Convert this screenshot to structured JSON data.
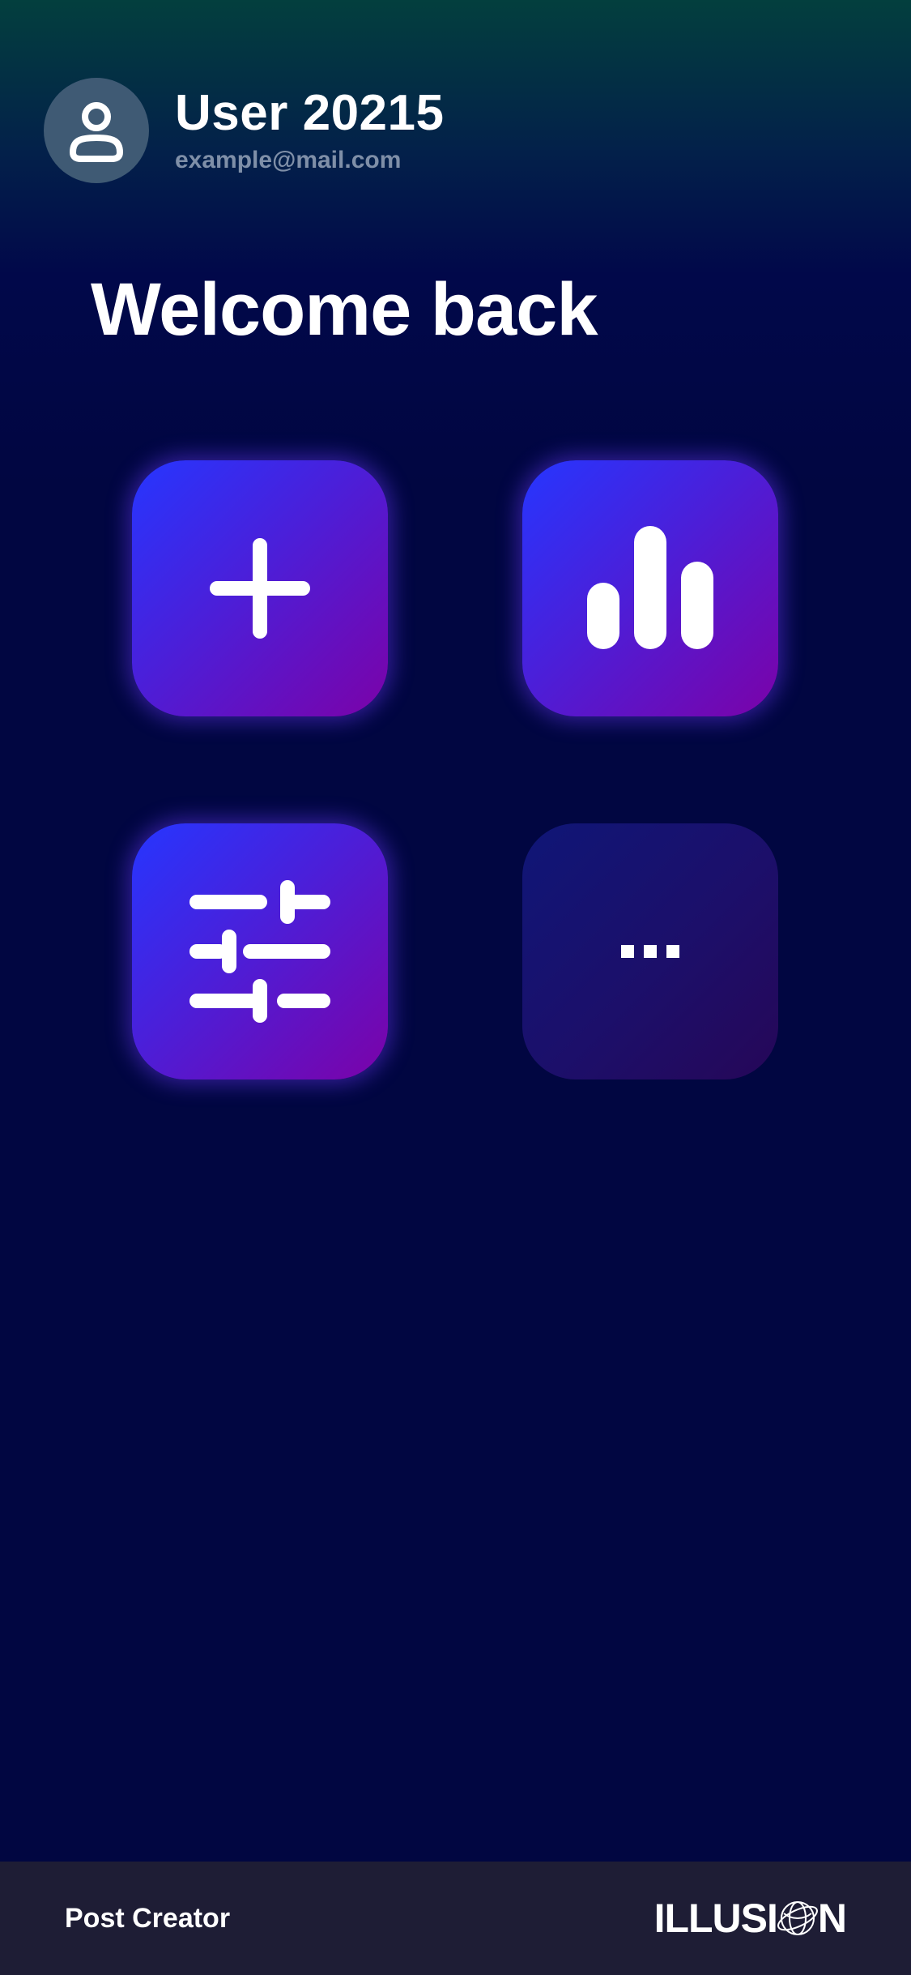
{
  "profile": {
    "avatar_icon": "user-icon",
    "username": "User 20215",
    "email": "example@mail.com"
  },
  "greeting": "Welcome back",
  "tiles": [
    {
      "icon": "plus-icon",
      "state": "active"
    },
    {
      "icon": "bar-chart-icon",
      "state": "active"
    },
    {
      "icon": "sliders-icon",
      "state": "active"
    },
    {
      "icon": "more-icon",
      "label": "...",
      "state": "muted"
    }
  ],
  "footer": {
    "app_name": "Post Creator",
    "brand_prefix": "ILLUSI",
    "brand_suffix": "N",
    "brand_mark_icon": "globe-logo-icon"
  },
  "colors": {
    "background": "#010641",
    "header_top": "#033f3e",
    "tile_gradient_start": "#2636ff",
    "tile_gradient_end": "#7b02a8",
    "muted_tile": "#141270",
    "footer": "#1e1d35",
    "email_text": "#7f8fa8"
  }
}
